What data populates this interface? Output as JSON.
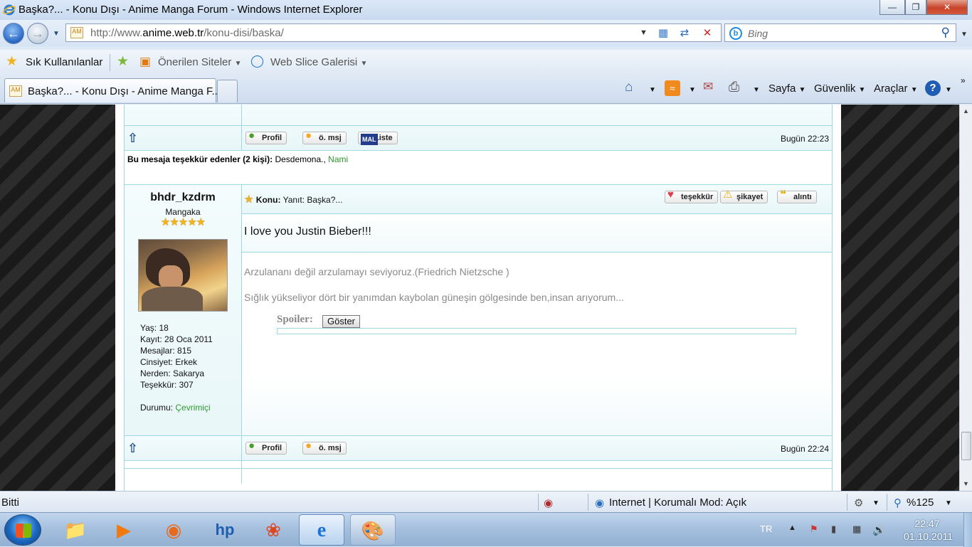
{
  "window": {
    "title": "Başka?... - Konu Dışı - Anime Manga Forum - Windows Internet Explorer",
    "minimize": "—",
    "restore": "❐",
    "close": "✕"
  },
  "address_bar": {
    "url_prefix": "http://www.",
    "url_domain": "anime.web.tr",
    "url_path": "/konu-disi/baska/",
    "search_placeholder": "Bing"
  },
  "favorites_bar": {
    "favorites_label": "Sık Kullanılanlar",
    "suggested_sites": "Önerilen Siteler",
    "web_slice": "Web Slice Galerisi"
  },
  "tab": {
    "title": "Başka?... - Konu Dışı - Anime Manga F..."
  },
  "command_bar": {
    "page": "Sayfa",
    "safety": "Güvenlik",
    "tools": "Araçlar"
  },
  "forum": {
    "post1": {
      "buttons": [
        "Profil",
        "ö. msj",
        "Liste"
      ],
      "time": "Bugün 22:23",
      "thanks_label": "Bu mesaja teşekkür edenler (2 kişi):",
      "thanks_user1": "Desdemona.,",
      "thanks_user2": "Nami"
    },
    "post2": {
      "username": "bhdr_kzdrm",
      "rank": "Mangaka",
      "rank_stars": 5,
      "info": [
        "Yaş: 18",
        "Kayıt: 28 Oca 2011",
        "Mesajlar: 815",
        "Cinsiyet: Erkek",
        "Nerden: Sakarya",
        "Teşekkür: 307"
      ],
      "status_label": "Durumu:",
      "status_value": "Çevrimiçi",
      "subject_label": "Konu:",
      "subject": "Yanıt: Başka?...",
      "actions": [
        "teşekkür",
        "şikayet",
        "alıntı"
      ],
      "message": "I love you Justin Bieber!!!",
      "signature_line1": "Arzulananı değil arzulamayı seviyoruz.(Friedrich Nietzsche )",
      "signature_line2": "Sığlık yükseliyor dört bir yanımdan kaybolan güneşin gölgesinde ben,insan arıyorum...",
      "spoiler_label": "Spoiler:",
      "spoiler_button": "Göster",
      "buttons": [
        "Profil",
        "ö. msj"
      ],
      "time": "Bugün 22:24"
    }
  },
  "status_bar": {
    "status": "Bitti",
    "zone": "Internet | Korumalı Mod: Açık",
    "zoom": "%125"
  },
  "taskbar": {
    "language": "TR",
    "time": "22:47",
    "date": "01.10.2011"
  },
  "colors": {
    "accent_border": "#9fd8e0",
    "online_green": "#2c9b2c",
    "signature_gray": "#8a8a8a"
  }
}
